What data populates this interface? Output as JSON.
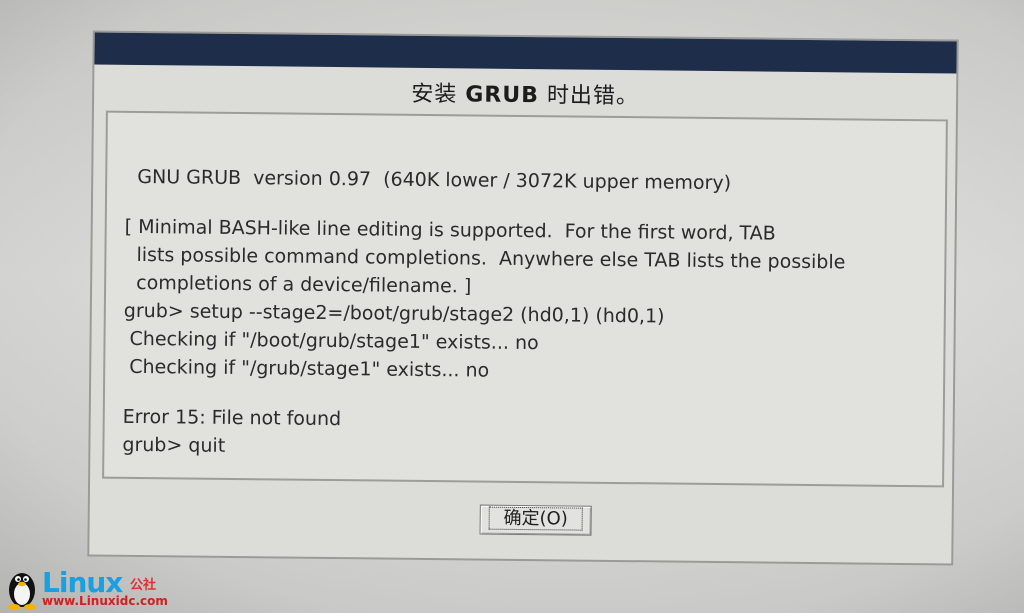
{
  "dialog": {
    "title_prefix": "安装",
    "title_bold": "GRUB",
    "title_suffix": "时出错。",
    "console_lines": [
      "  GNU GRUB  version 0.97  (640K lower / 3072K upper memory)",
      "",
      "[ Minimal BASH-like line editing is supported.  For the first word, TAB",
      "  lists possible command completions.  Anywhere else TAB lists the possible",
      "  completions of a device/filename. ]",
      "grub> setup --stage2=/boot/grub/stage2 (hd0,1) (hd0,1)",
      " Checking if \"/boot/grub/stage1\" exists... no",
      " Checking if \"/grub/stage1\" exists... no",
      "",
      "Error 15: File not found",
      "grub> quit"
    ],
    "ok_label": "确定(O)"
  },
  "watermark": {
    "brand": "Linux",
    "brand_sub": "公社",
    "url": "www.Linuxidc.com"
  },
  "colors": {
    "titlebar": "#1d2d4a",
    "watermark_blue": "#1a9fe0",
    "watermark_red": "#d02020"
  }
}
